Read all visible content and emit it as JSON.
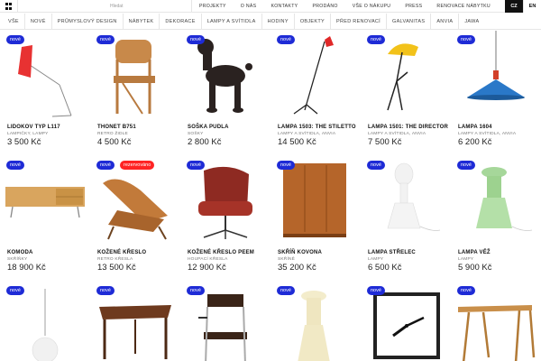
{
  "search": {
    "placeholder": "Hledat"
  },
  "topnav": [
    "PROJEKTY",
    "O NÁS",
    "KONTAKTY",
    "PRODÁNO",
    "VŠE O NÁKUPU",
    "PRESS",
    "RENOVACE NÁBYTKU"
  ],
  "lang": {
    "active": "CZ",
    "other": "EN"
  },
  "categories": [
    "VŠE",
    "NOVÉ",
    "PRŮMYSLOVÝ DESIGN",
    "NÁBYTEK",
    "DEKORACE",
    "LAMPY A SVÍTIDLA",
    "HODINY",
    "OBJEKTY",
    "PŘED RENOVACÍ",
    "GALVANITAS",
    "ANVIA",
    "JAWA"
  ],
  "badge_new": "nové",
  "badge_reserved": "rezervováno",
  "products": [
    {
      "name": "LIDOKOV TYP L117",
      "category": "LAMPIČKY, LAMPY",
      "price": "3 500 Kč",
      "icon": "floor-lamp-red"
    },
    {
      "name": "THONET B751",
      "category": "RETRO ŽIDLE",
      "price": "4 500 Kč",
      "icon": "folding-chair"
    },
    {
      "name": "SOŠKA PUDLA",
      "category": "SOŠKY",
      "price": "2 800 Kč",
      "icon": "poodle-statue"
    },
    {
      "name": "LAMPA 1503: THE STILETTO",
      "category": "LAMPY A SVÍTIDLA, ANVIA",
      "price": "14 500 Kč",
      "icon": "stiletto-lamp"
    },
    {
      "name": "LAMPA 1501: THE DIRECTOR",
      "category": "LAMPY A SVÍTIDLA, ANVIA",
      "price": "7 500 Kč",
      "icon": "director-lamp"
    },
    {
      "name": "LAMPA 1604",
      "category": "LAMPY A SVÍTIDLA, ANVIA",
      "price": "6 200 Kč",
      "icon": "pendant-lamp"
    },
    {
      "name": "KOMODA",
      "category": "SKŘÍŇKY",
      "price": "18 900 Kč",
      "icon": "sideboard"
    },
    {
      "name": "KOŽENÉ KŘESLO",
      "category": "RETRO KŘESLA",
      "price": "13 500 Kč",
      "icon": "leather-lounge-chair",
      "reserved": true
    },
    {
      "name": "KOŽENÉ KŘESLO PEEM",
      "category": "HOUPACÍ KŘESLA",
      "price": "12 900 Kč",
      "icon": "swivel-armchair"
    },
    {
      "name": "SKŘÍŇ KOVONA",
      "category": "SKŘÍNĚ",
      "price": "35 200 Kč",
      "icon": "wardrobe"
    },
    {
      "name": "LAMPA STŘELEC",
      "category": "LAMPY",
      "price": "6 500 Kč",
      "icon": "glass-lamp-white"
    },
    {
      "name": "LAMPA VĚŽ",
      "category": "LAMPY",
      "price": "5 900 Kč",
      "icon": "glass-lamp-green"
    },
    {
      "name": "",
      "category": "",
      "price": "",
      "icon": "globe-pendant"
    },
    {
      "name": "",
      "category": "",
      "price": "",
      "icon": "coffee-table"
    },
    {
      "name": "",
      "category": "",
      "price": "",
      "icon": "tubular-chair"
    },
    {
      "name": "",
      "category": "",
      "price": "",
      "icon": "cream-glass-lamp"
    },
    {
      "name": "",
      "category": "",
      "price": "",
      "icon": "wall-clock"
    },
    {
      "name": "",
      "category": "",
      "price": "",
      "icon": "writing-desk"
    }
  ]
}
